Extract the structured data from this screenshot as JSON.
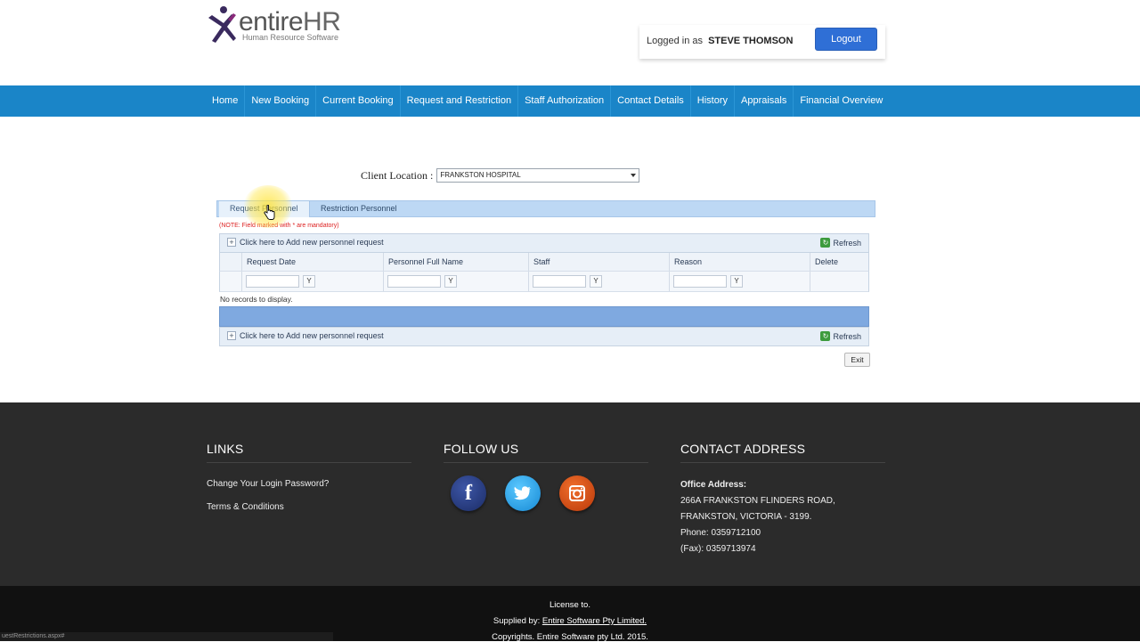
{
  "brand": {
    "name_entire": "entire",
    "name_hr": "HR",
    "tagline": "Human Resource Software"
  },
  "session": {
    "logged_in_label": "Logged in as",
    "user_name": "STEVE THOMSON",
    "logout_label": "Logout"
  },
  "nav": {
    "items": [
      "Home",
      "New Booking",
      "Current Booking",
      "Request and Restriction",
      "Staff Authorization",
      "Contact Details",
      "History",
      "Appraisals",
      "Financial Overview"
    ]
  },
  "client_location": {
    "label": "Client Location :",
    "selected": "FRANKSTON HOSPITAL"
  },
  "tabs": {
    "request": "Request Personnel",
    "restriction": "Restriction Personnel"
  },
  "note": "(NOTE: Field marked with * are mandatory)",
  "grid": {
    "add_label": "Click here to Add new personnel request",
    "refresh_label": "Refresh",
    "columns": [
      "Request Date",
      "Personnel Full Name",
      "Staff",
      "Reason",
      "Delete"
    ],
    "filter_icon": "Y",
    "no_records": "No records to display.",
    "exit_label": "Exit"
  },
  "footer": {
    "links_title": "LINKS",
    "links": [
      "Change Your Login Password?",
      "Terms & Conditions"
    ],
    "follow_title": "FOLLOW US",
    "social": [
      "facebook-icon",
      "twitter-icon",
      "instagram-icon"
    ],
    "contact_title": "CONTACT ADDRESS",
    "office_label": "Office Address:",
    "address_line1": "266A FRANKSTON FLINDERS ROAD,",
    "address_line2": "FRANKSTON, VICTORIA - 3199.",
    "phone": "Phone: 0359712100",
    "fax": "(Fax): 0359713974"
  },
  "bottom": {
    "license": "License to.",
    "supplied_by_label": "Supplied by:",
    "supplied_by_link": "Entire Software Pty Limited.",
    "copyright": "Copyrights. Entire Software pty Ltd. 2015."
  },
  "status_url": "uestRestrictions.aspx#",
  "colors": {
    "nav_bg": "#1a85c8",
    "logout_bg": "#2f6fd6",
    "footer_bg": "#2b2b2b",
    "pager_bg": "#7fa9e0"
  }
}
